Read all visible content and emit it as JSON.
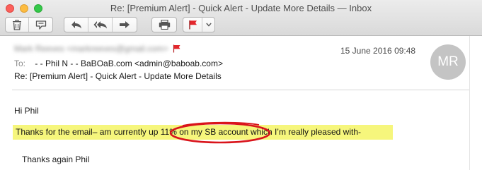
{
  "window": {
    "title": "Re: [Premium Alert] - Quick Alert - Update More Details — Inbox"
  },
  "toolbar": {
    "buttons": [
      {
        "name": "delete",
        "icon": "trash-icon"
      },
      {
        "name": "junk",
        "icon": "junk-icon"
      },
      {
        "name": "reply",
        "icon": "reply-icon"
      },
      {
        "name": "reply-all",
        "icon": "reply-all-icon"
      },
      {
        "name": "forward",
        "icon": "forward-icon"
      },
      {
        "name": "print",
        "icon": "print-icon"
      },
      {
        "name": "flag",
        "icon": "flag-icon"
      },
      {
        "name": "flag-menu",
        "icon": "chevron-down-icon"
      }
    ],
    "flag_color": "#e3272d"
  },
  "header": {
    "from": "Mark Reeves <markreeves@gmail.com>",
    "date": "15 June 2016 09:48",
    "to_label": "To:",
    "to_value": "- - Phil N - - BaBOaB.com <admin@baboab.com>",
    "subject": "Re: [Premium Alert] - Quick Alert - Update More Details",
    "avatar_initials": "MR"
  },
  "body": {
    "greeting": "Hi Phil",
    "line_before": "Thanks for the email– am currently up ",
    "line_marked": "11% on my SB account",
    "line_after": " which I’m really pleased with-",
    "highlight_color": "#f6f67c",
    "circle_color": "#d9141b",
    "signoff": "Thanks again Phil"
  }
}
